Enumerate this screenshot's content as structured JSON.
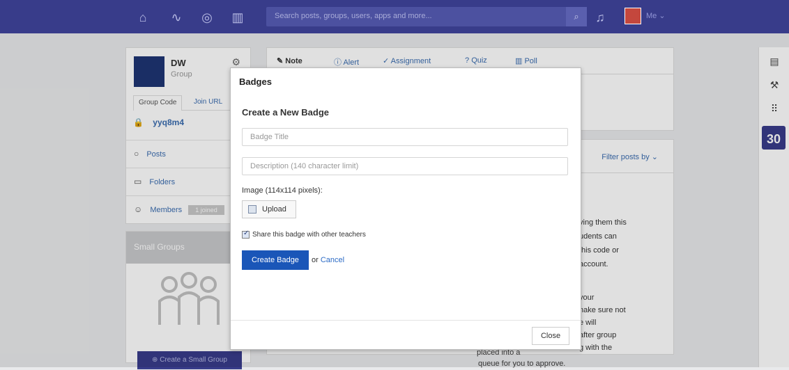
{
  "topbar": {
    "search_placeholder": "Search posts, groups, users, apps and more...",
    "me_label": "Me ⌄"
  },
  "group": {
    "initials": "DW",
    "type": "Group",
    "tabs": [
      "Group Code",
      "Join URL"
    ],
    "code": "yyq8m4"
  },
  "sidebar_menu": [
    {
      "label": "Posts"
    },
    {
      "label": "Folders"
    },
    {
      "label": "Members",
      "badge": "1 joined"
    }
  ],
  "small_groups": {
    "title": "Small Groups",
    "create_label": "Create a Small Group"
  },
  "post_tabs": [
    "Note",
    "Alert",
    "Assignment",
    "Quiz",
    "Poll"
  ],
  "filter_label": "Filter posts by ⌄",
  "background_text": [
    "ving them this",
    "udents can",
    "this code or",
    "account.",
    "your",
    "nake sure not",
    "e will",
    "after group",
    "g with the",
    "placed into a",
    "queue for you to approve."
  ],
  "modal": {
    "title": "Badges",
    "subtitle": "Create a New Badge",
    "badge_title_placeholder": "Badge Title",
    "description_placeholder": "Description (140 character limit)",
    "image_label": "Image (114x114 pixels):",
    "upload_label": "Upload",
    "share_label": "Share this badge with other teachers",
    "share_checked": true,
    "create_label": "Create Badge",
    "or_label": "or",
    "cancel_label": "Cancel",
    "close_label": "Close"
  },
  "rail": {
    "calendar_day": "30"
  },
  "colors": {
    "topbar": "#383c8a",
    "primary_button": "#1a56b8",
    "group_avatar": "#1e3574",
    "link": "#3b6db0"
  }
}
